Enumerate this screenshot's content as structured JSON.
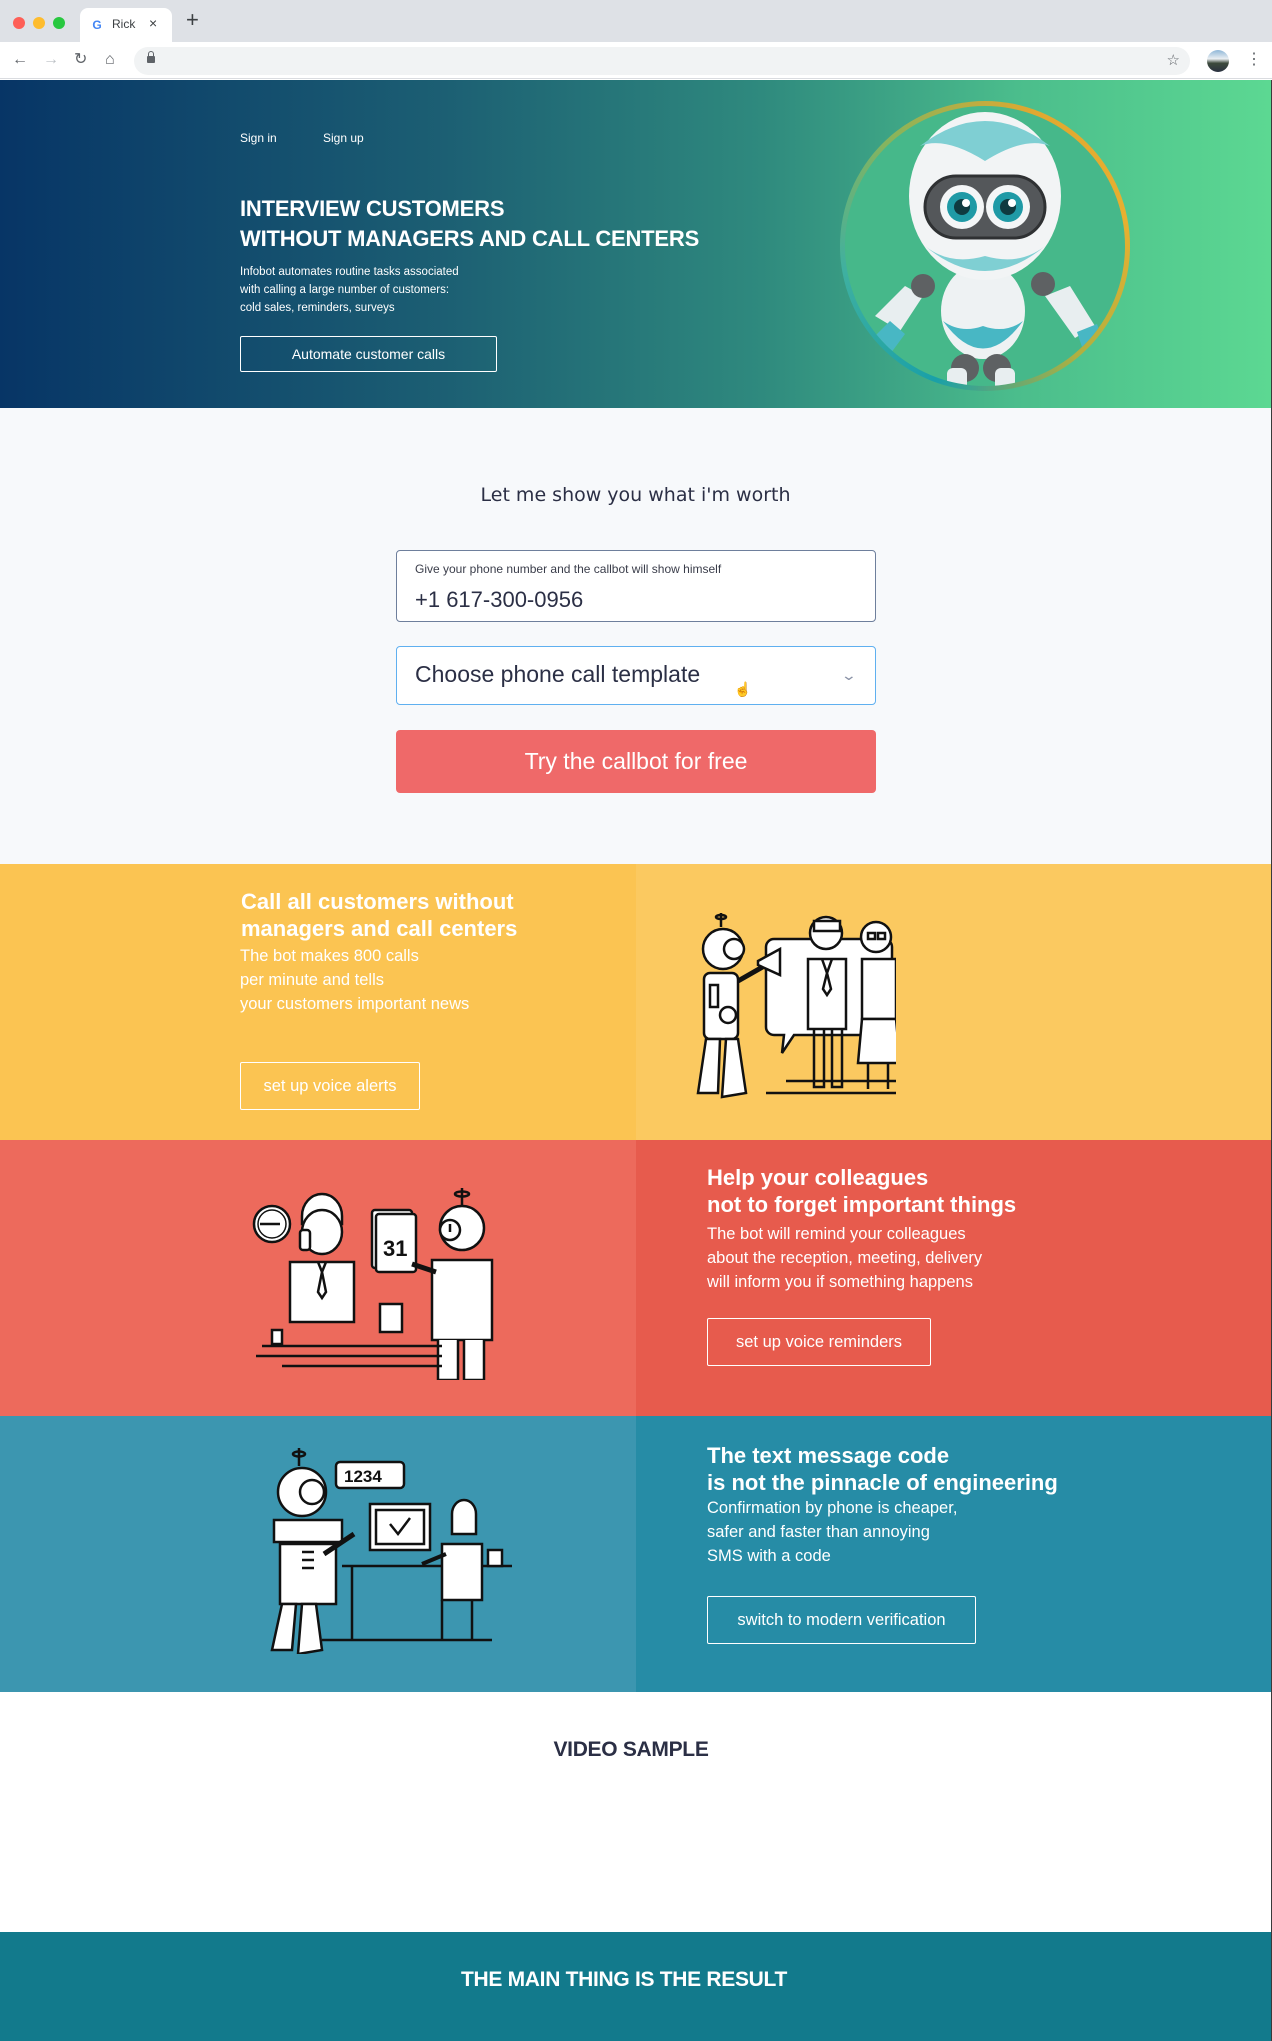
{
  "browser": {
    "tab_title": "Rick",
    "tab_favicon": "google-g-icon",
    "tab_close": "×",
    "new_tab": "+",
    "nav": {
      "back": "←",
      "forward": "→",
      "reload": "↻",
      "home": "⌂"
    },
    "bookmark_star": "☆",
    "menu": "⋮",
    "url": ""
  },
  "hero": {
    "nav": {
      "sign_in": "Sign in",
      "sign_up": "Sign up"
    },
    "title_line1": "INTERVIEW CUSTOMERS",
    "title_line2": "WITHOUT MANAGERS AND CALL CENTERS",
    "desc_line1": "Infobot automates routine tasks associated",
    "desc_line2": "with calling a large number of customers:",
    "desc_line3": "cold sales, reminders, surveys",
    "button": "Automate customer calls",
    "image": "robot-mascot"
  },
  "demo": {
    "title": "Let me show you what i'm worth",
    "phone_label": "Give your phone number and the callbot will show himself",
    "phone_value": "+1 617-300-0956",
    "template_select": "Choose phone call template",
    "chevron": "⌄",
    "cta": "Try the callbot for free"
  },
  "features": [
    {
      "title_line1": "Call all customers without",
      "title_line2": "managers and call centers",
      "desc_line1": "The bot makes 800 calls",
      "desc_line2": "per minute and tells",
      "desc_line3": "your customers important news",
      "button": "set up voice alerts",
      "illustration": "robot-megaphone-people"
    },
    {
      "title_line1": "Help your colleagues",
      "title_line2": "not to forget important things",
      "desc_line1": "The bot will remind your colleagues",
      "desc_line2": "about the reception, meeting, delivery",
      "desc_line3": "will inform you if something happens",
      "button": "set up voice reminders",
      "illustration": "robot-calendar-office",
      "calendar_day": "31"
    },
    {
      "title_line1": "The text message code",
      "title_line2": "is not the pinnacle of engineering",
      "desc_line1": "Confirmation by phone is cheaper,",
      "desc_line2": "safer and faster than annoying",
      "desc_line3": "SMS with a code",
      "button": "switch to modern  verification",
      "illustration": "robot-code-computer",
      "code_bubble": "1234"
    }
  ],
  "video": {
    "title": "VIDEO SAMPLE"
  },
  "result": {
    "title": "THE MAIN THING IS THE RESULT"
  },
  "colors": {
    "hero_start": "#073566",
    "hero_end": "#5cd892",
    "cta": "#ef6969",
    "yellow": "#fbc452",
    "red": "#e75b4d",
    "blue": "#268ca6",
    "footer_teal": "#127a8c",
    "text_dark": "#2b2f45"
  }
}
